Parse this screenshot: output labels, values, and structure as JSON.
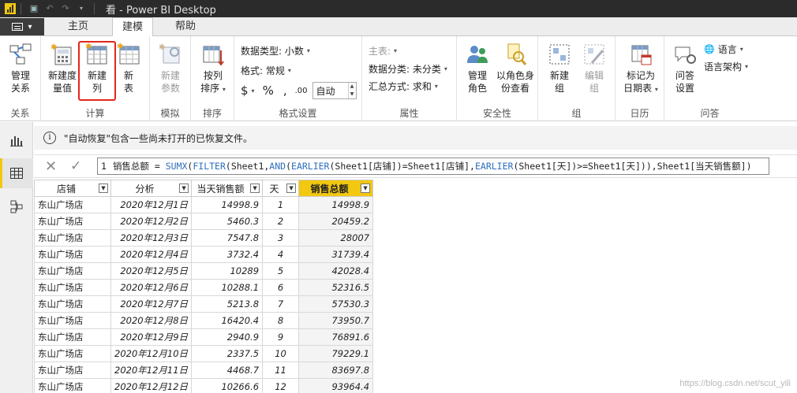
{
  "window": {
    "title": "看 - Power BI Desktop"
  },
  "tabs": [
    {
      "label": "主页"
    },
    {
      "label": "建模"
    },
    {
      "label": "帮助"
    }
  ],
  "ribbon": {
    "groups": {
      "relations": {
        "label": "关系",
        "button": [
          "管理",
          "关系"
        ]
      },
      "compute": {
        "label": "计算",
        "new_measure": [
          "新建度",
          "量值"
        ],
        "new_column": [
          "新建",
          "列"
        ],
        "new_table": [
          "新",
          "表"
        ]
      },
      "whatif": {
        "label": "模拟",
        "new_param": [
          "新建",
          "参数"
        ]
      },
      "sort": {
        "label": "排序",
        "sort_by": [
          "按列",
          "排序"
        ]
      },
      "format": {
        "label": "格式设置",
        "data_type": "数据类型: 小数",
        "format": "格式: 常规",
        "currency": "$",
        "percent": "%",
        "comma": ",",
        "decimal": ".00",
        "auto_value": "自动"
      },
      "props": {
        "label": "属性",
        "home_table": "主表:",
        "category": "数据分类: 未分类",
        "summarize": "汇总方式: 求和"
      },
      "security": {
        "label": "安全性",
        "manage_roles": [
          "管理",
          "角色"
        ],
        "view_as": [
          "以角色身",
          "份查看"
        ]
      },
      "groups": {
        "label": "组",
        "new_group": [
          "新建",
          "组"
        ],
        "edit_group": [
          "编辑",
          "组"
        ]
      },
      "calendar": {
        "label": "日历",
        "mark_date": [
          "标记为",
          "日期表"
        ]
      },
      "qa": {
        "label": "问答",
        "qa_settings": [
          "问答",
          "设置"
        ],
        "language": "语言",
        "schema": "语言架构"
      }
    }
  },
  "infobar": {
    "text": "\"自动恢复\"包含一些尚未打开的已恢复文件。"
  },
  "formula": {
    "line": "1",
    "parts": [
      {
        "t": "销售总额 = ",
        "fn": false
      },
      {
        "t": "SUMX",
        "fn": true
      },
      {
        "t": "(",
        "fn": false
      },
      {
        "t": "FILTER",
        "fn": true
      },
      {
        "t": "(Sheet1,",
        "fn": false
      },
      {
        "t": "AND",
        "fn": true
      },
      {
        "t": "(",
        "fn": false
      },
      {
        "t": "EARLIER",
        "fn": true
      },
      {
        "t": "(Sheet1[店铺])=Sheet1[店铺],",
        "fn": false
      },
      {
        "t": "EARLIER",
        "fn": true
      },
      {
        "t": "(Sheet1[天])>=Sheet1[天])),Sheet1[当天销售额])",
        "fn": false
      }
    ]
  },
  "table": {
    "columns": [
      "店铺",
      "分析",
      "当天销售额",
      "天",
      "销售总额"
    ],
    "rows": [
      [
        "东山广场店",
        "2020年12月1日",
        "14998.9",
        "1",
        "14998.9"
      ],
      [
        "东山广场店",
        "2020年12月2日",
        "5460.3",
        "2",
        "20459.2"
      ],
      [
        "东山广场店",
        "2020年12月3日",
        "7547.8",
        "3",
        "28007"
      ],
      [
        "东山广场店",
        "2020年12月4日",
        "3732.4",
        "4",
        "31739.4"
      ],
      [
        "东山广场店",
        "2020年12月5日",
        "10289",
        "5",
        "42028.4"
      ],
      [
        "东山广场店",
        "2020年12月6日",
        "10288.1",
        "6",
        "52316.5"
      ],
      [
        "东山广场店",
        "2020年12月7日",
        "5213.8",
        "7",
        "57530.3"
      ],
      [
        "东山广场店",
        "2020年12月8日",
        "16420.4",
        "8",
        "73950.7"
      ],
      [
        "东山广场店",
        "2020年12月9日",
        "2940.9",
        "9",
        "76891.6"
      ],
      [
        "东山广场店",
        "2020年12月10日",
        "2337.5",
        "10",
        "79229.1"
      ],
      [
        "东山广场店",
        "2020年12月11日",
        "4468.7",
        "11",
        "83697.8"
      ],
      [
        "东山广场店",
        "2020年12月12日",
        "10266.6",
        "12",
        "93964.4"
      ]
    ]
  },
  "watermark": "https://blog.csdn.net/scut_yili",
  "colors": {
    "accent": "#f2c811",
    "highlight_box": "#e3261c",
    "title_bg": "#2b2b2b"
  }
}
